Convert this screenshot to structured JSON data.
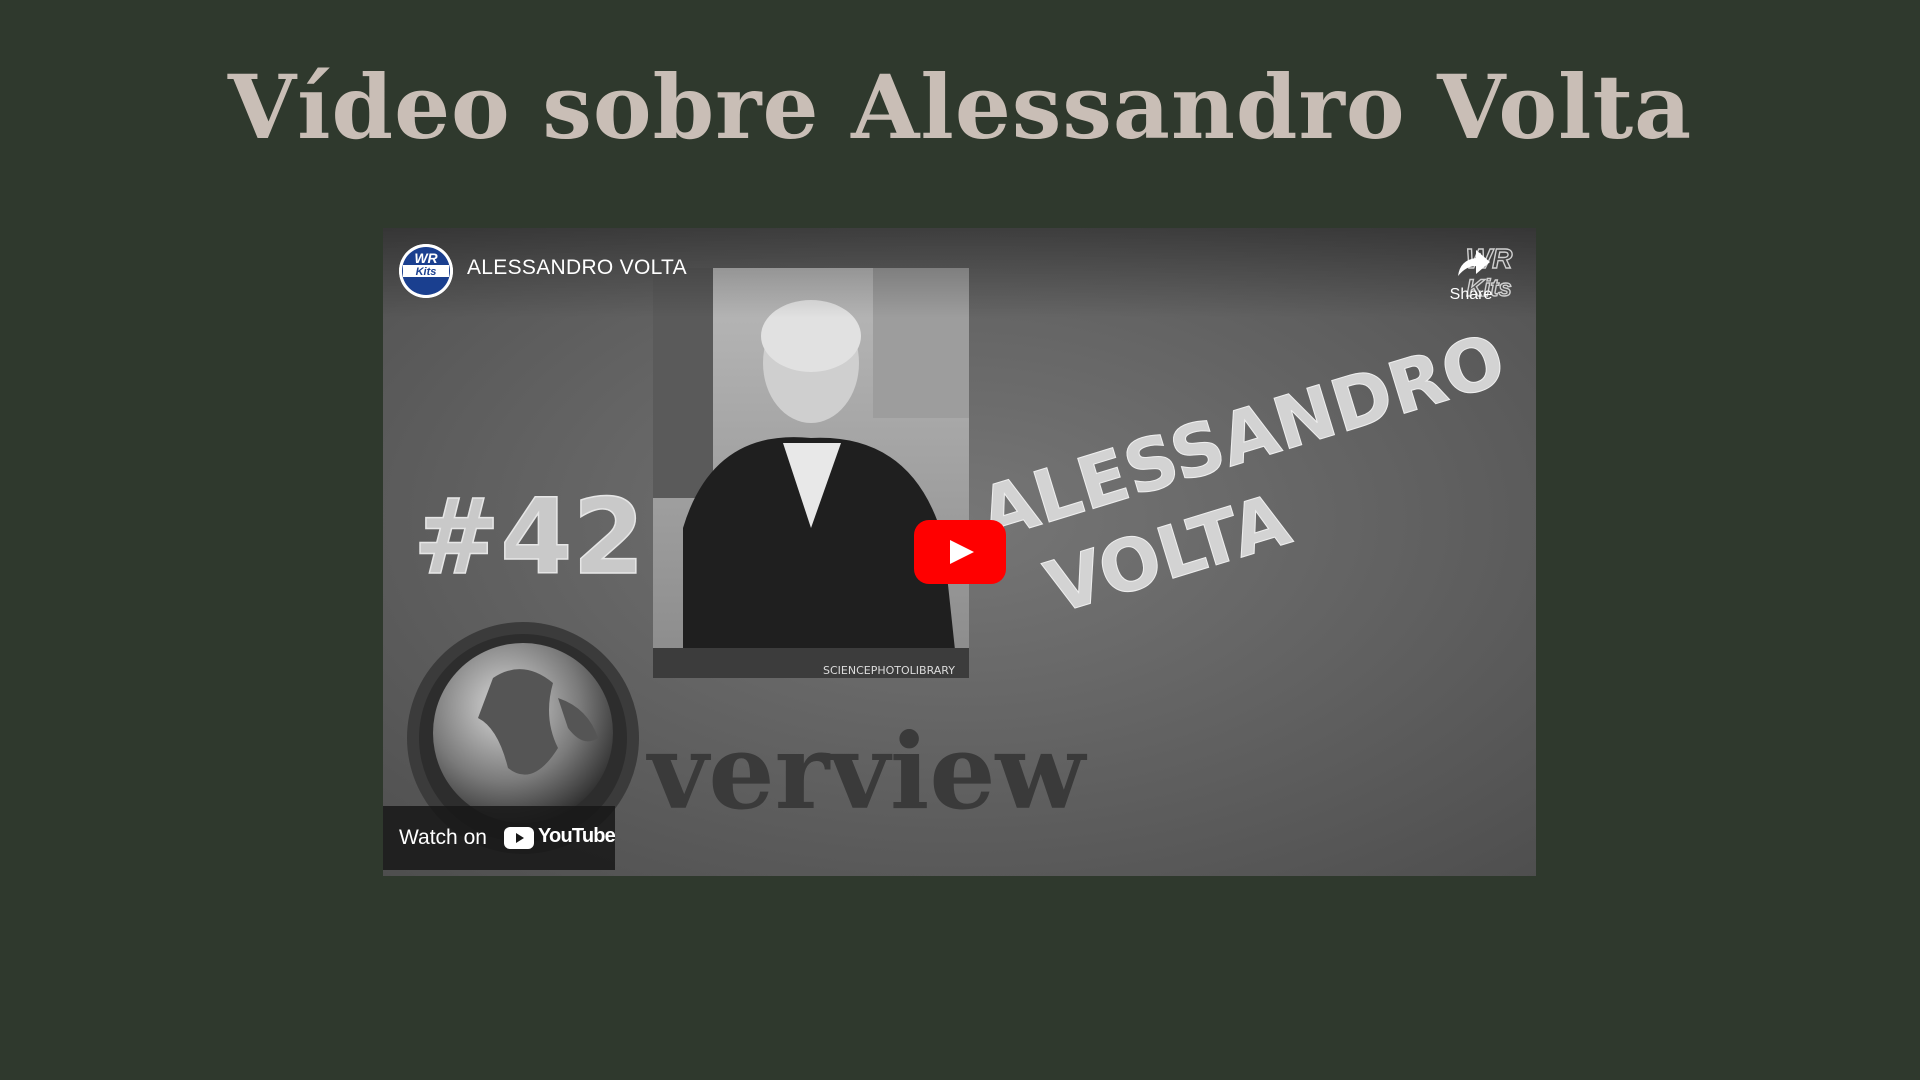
{
  "page": {
    "title": "Vídeo sobre Alessandro Volta"
  },
  "video": {
    "title": "ALESSANDRO VOLTA",
    "channel_logo_text": "WR Kits",
    "share_label": "Share",
    "watch_on_label": "Watch on",
    "youtube_label": "YouTube",
    "thumbnail": {
      "episode_number": "#42",
      "headline_line1": "ALESSANDRO",
      "headline_line2": "VOLTA",
      "overview_text": "verview",
      "photo_credit": "SCIENCEPHOTOLIBRARY"
    }
  },
  "colors": {
    "background": "#2f392d",
    "title": "#c9beb6",
    "play_red": "#ff0000",
    "chalkboard": "#6b6b6b"
  },
  "icons": {
    "play": "play-icon",
    "share": "share-arrow-icon",
    "youtube": "youtube-logo-icon"
  }
}
